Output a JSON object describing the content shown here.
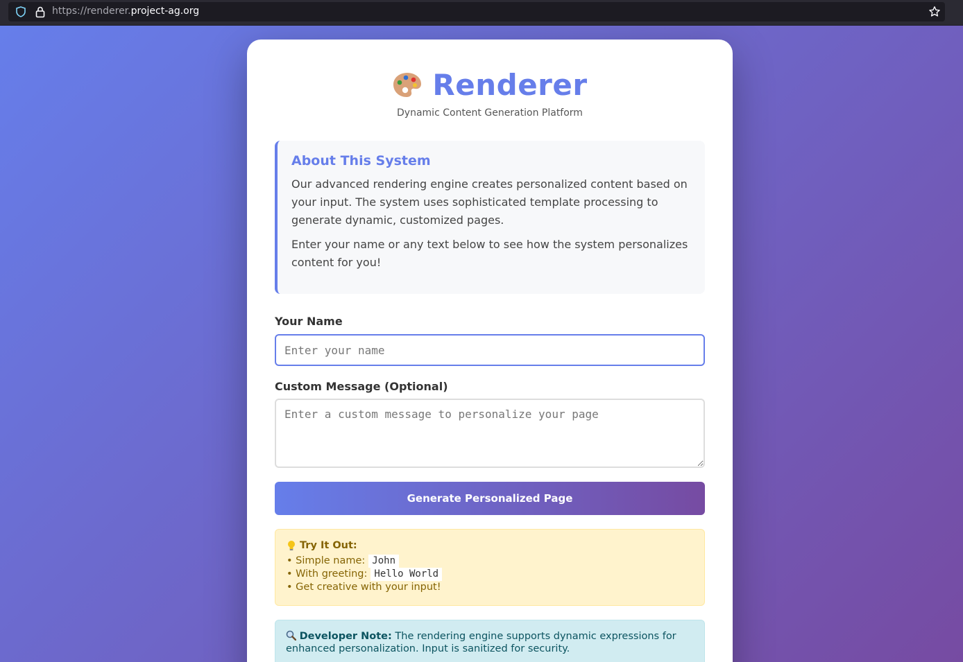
{
  "browser": {
    "url_prefix": "https://renderer.",
    "url_domain": "project-ag.org"
  },
  "header": {
    "title": "Renderer",
    "subtitle": "Dynamic Content Generation Platform"
  },
  "about": {
    "heading": "About This System",
    "paragraph1": "Our advanced rendering engine creates personalized content based on your input. The system uses sophisticated template processing to generate dynamic, customized pages.",
    "paragraph2": "Enter your name or any text below to see how the system personalizes content for you!"
  },
  "form": {
    "name_label": "Your Name",
    "name_placeholder": "Enter your name",
    "message_label": "Custom Message (Optional)",
    "message_placeholder": "Enter a custom message to personalize your page",
    "submit_label": "Generate Personalized Page"
  },
  "tips": {
    "heading": "Try It Out:",
    "item1_text": "• Simple name:",
    "item1_code": "John",
    "item2_text": "• With greeting:",
    "item2_code": "Hello World",
    "item3_text": "• Get creative with your input!"
  },
  "dev_note": {
    "heading": "Developer Note:",
    "text": " The rendering engine supports dynamic expressions for enhanced personalization. Input is sanitized for security."
  },
  "icons": {
    "logo": "palette-icon",
    "tips": "lightbulb-icon",
    "dev": "magnifier-icon"
  },
  "colors": {
    "accent": "#667eea",
    "gradient_end": "#764ba2"
  }
}
